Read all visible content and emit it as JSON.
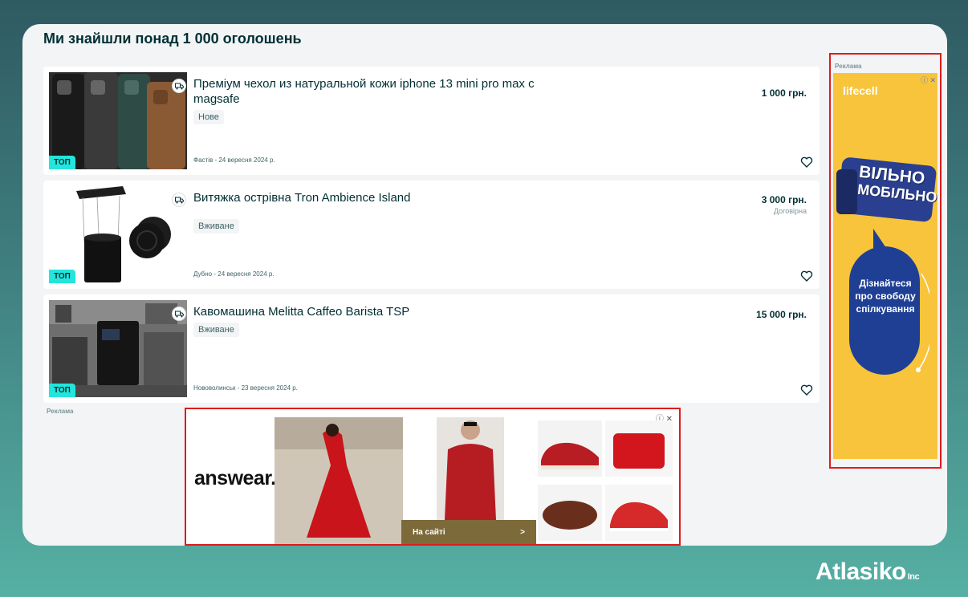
{
  "headline": "Ми знайшли понад 1 000 оголошень",
  "listings": [
    {
      "title": "Преміум чехол из натуральной кожи iphone 13 mini pro max с magsafe",
      "condition": "Нове",
      "location_date": "Фастів - 24 вересня 2024 р.",
      "price": "1 000 грн.",
      "negotiable": "",
      "badge": "ТОП"
    },
    {
      "title": "Витяжка острівна Tron Ambience Island",
      "condition": "Вживане",
      "location_date": "Дубно - 24 вересня 2024 р.",
      "price": "3 000 грн.",
      "negotiable": "Договірна",
      "badge": "ТОП"
    },
    {
      "title": "Кавомашина Melitta Caffeo Barista TSP",
      "condition": "Вживане",
      "location_date": "Нововолинськ - 23 вересня 2024 р.",
      "price": "15 000 грн.",
      "negotiable": "",
      "badge": "ТОП"
    }
  ],
  "ads": {
    "label": "Реклама",
    "right": {
      "brand": "lifecell",
      "phone_text_1": "ВІЛЬНО",
      "phone_text_2": "МОБІЛЬНО",
      "bubble_text": "Дізнайтеся про свободу спілкування"
    },
    "bottom": {
      "brand": "answear.",
      "cta": "На сайті",
      "cta_arrow": ">"
    },
    "info_close": "ⓘ ✕"
  },
  "brand": {
    "name": "Atlasiko",
    "suffix": "Inc"
  },
  "colors": {
    "accent_top": "#23e5db",
    "text_dark": "#002f34",
    "ad_border": "#e01b1b",
    "lifecell_yellow": "#f8c43b"
  }
}
